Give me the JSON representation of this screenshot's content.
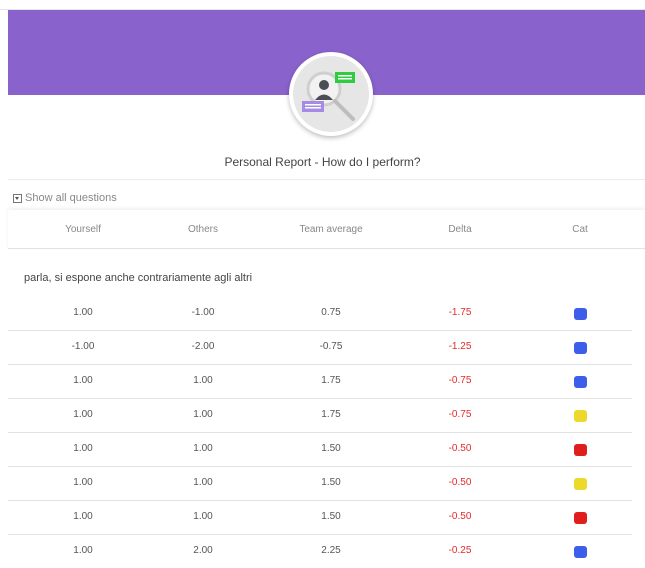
{
  "report": {
    "title": "Personal Report - How do I perform?",
    "show_all_questions": "Show all questions"
  },
  "table": {
    "headers": [
      "Yourself",
      "Others",
      "Team average",
      "Delta",
      "Cat"
    ],
    "section_label": "parla, si espone anche contrariamente agli altri",
    "rows": [
      {
        "yourself": "1.00",
        "others": "-1.00",
        "team_average": "0.75",
        "delta": "-1.75",
        "cat_color": "#3d5ee8"
      },
      {
        "yourself": "-1.00",
        "others": "-2.00",
        "team_average": "-0.75",
        "delta": "-1.25",
        "cat_color": "#3d5ee8"
      },
      {
        "yourself": "1.00",
        "others": "1.00",
        "team_average": "1.75",
        "delta": "-0.75",
        "cat_color": "#3d5ee8"
      },
      {
        "yourself": "1.00",
        "others": "1.00",
        "team_average": "1.75",
        "delta": "-0.75",
        "cat_color": "#ecd92c"
      },
      {
        "yourself": "1.00",
        "others": "1.00",
        "team_average": "1.50",
        "delta": "-0.50",
        "cat_color": "#e01e1e"
      },
      {
        "yourself": "1.00",
        "others": "1.00",
        "team_average": "1.50",
        "delta": "-0.50",
        "cat_color": "#ecd92c"
      },
      {
        "yourself": "1.00",
        "others": "1.00",
        "team_average": "1.50",
        "delta": "-0.50",
        "cat_color": "#e01e1e"
      },
      {
        "yourself": "1.00",
        "others": "2.00",
        "team_average": "2.25",
        "delta": "-0.25",
        "cat_color": "#3d5ee8"
      }
    ]
  },
  "colors": {
    "banner": "#8a62cb",
    "delta_negative": "#e32b2b"
  },
  "icons": {
    "avatar": "user-search-icon"
  }
}
